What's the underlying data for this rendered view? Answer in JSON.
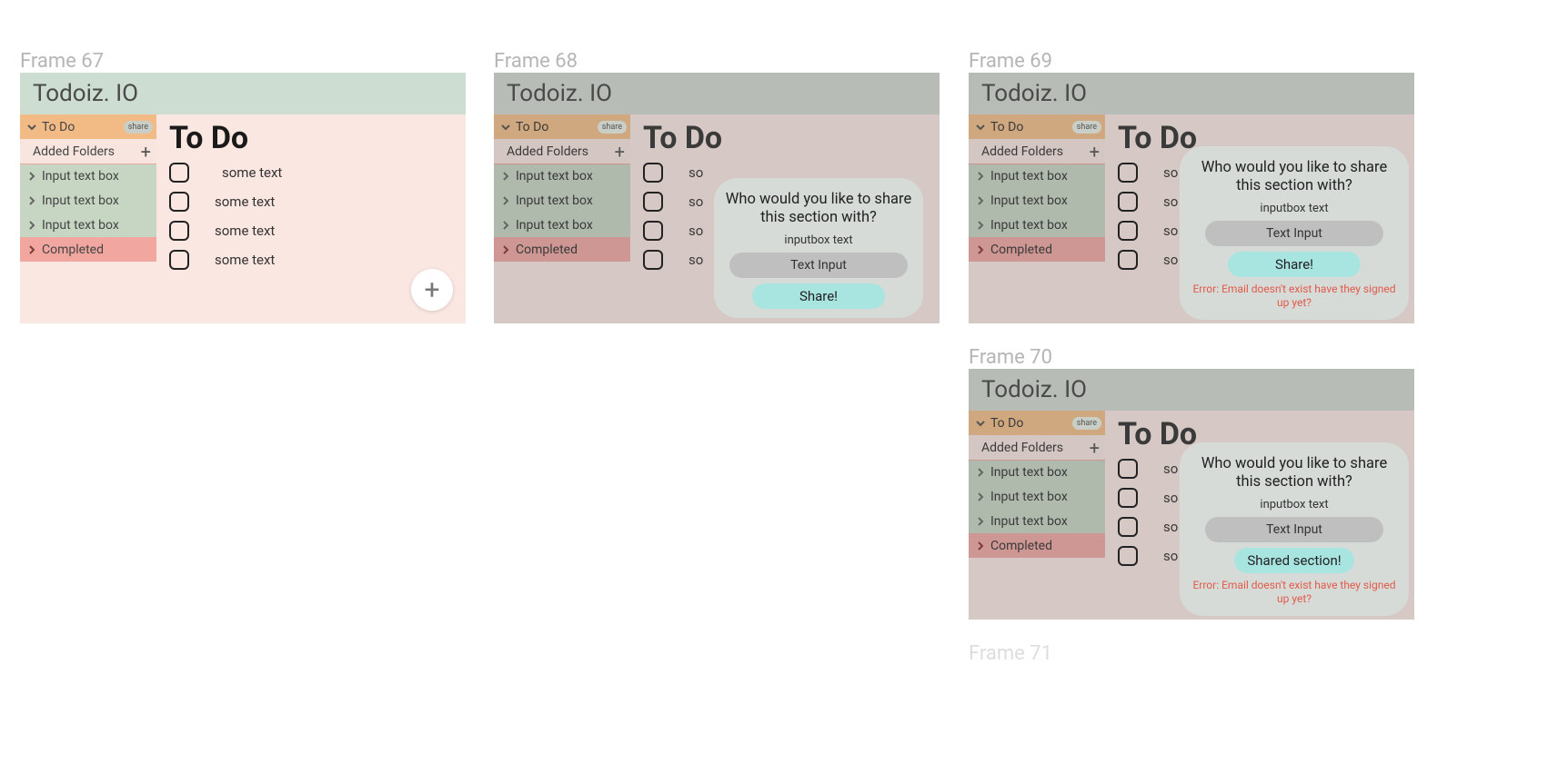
{
  "labels": {
    "f67": "Frame 67",
    "f68": "Frame 68",
    "f69": "Frame 69",
    "f70": "Frame 70",
    "f71": "Frame 71"
  },
  "app_title": "Todoiz. IO",
  "sidebar": {
    "todo": "To Do",
    "share": "share",
    "added": "Added Folders",
    "input": "Input text box",
    "completed": "Completed"
  },
  "main": {
    "title": "To Do",
    "item": "some text",
    "item_short": "so"
  },
  "modal": {
    "question": "Who would you like to share this section with?",
    "placeholder": "inputbox text",
    "input": "Text Input",
    "share_btn": "Share!",
    "shared_btn": "Shared section!",
    "error": "Error: Email doesn't exist have they signed up yet?"
  }
}
